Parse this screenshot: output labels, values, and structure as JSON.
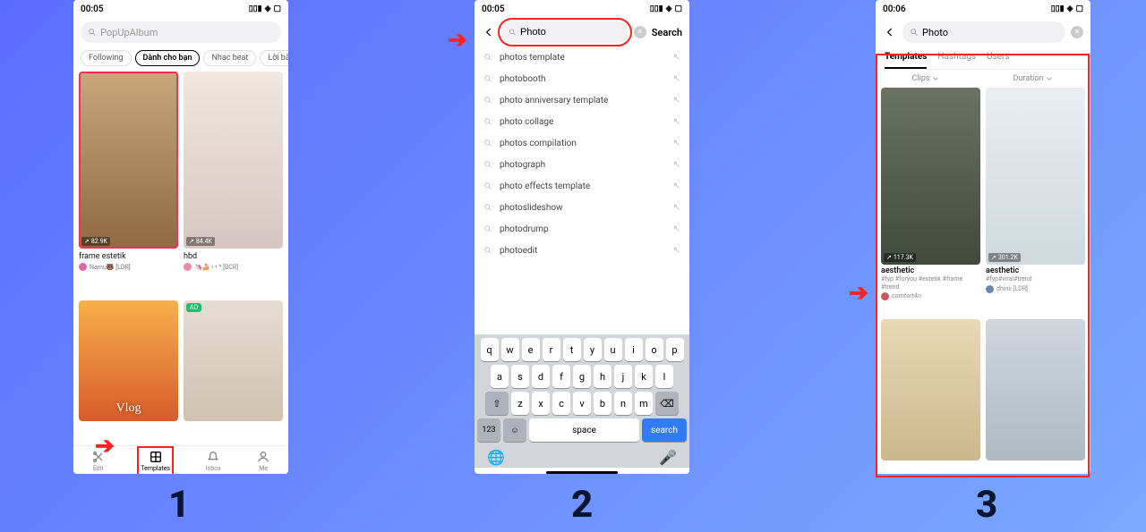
{
  "status": {
    "time1": "00:05",
    "time2": "00:05",
    "time3": "00:06"
  },
  "p1": {
    "search_placeholder": "PopUpAlbum",
    "filters": [
      "Following",
      "Dành cho bạn",
      "Nhạc beat",
      "Lời bài"
    ],
    "cards": [
      {
        "title": "frame estetik",
        "user": "Namu🐻 [LDR]",
        "uses": "82.9K",
        "cls": "img-a"
      },
      {
        "title": "hbd",
        "user": "🦄🍰 • • * [BCR]",
        "uses": "84.4K",
        "cls": "img-b"
      }
    ],
    "more": [
      {
        "label": "Vlog",
        "cls": "img-c"
      },
      {
        "label": "",
        "cls": "img-d",
        "ad": "AD"
      }
    ],
    "tabs": [
      "Edit",
      "Templates",
      "Inbox",
      "Me"
    ]
  },
  "p2": {
    "query": "Photo",
    "search_action": "Search",
    "suggestions": [
      "photos template",
      "photobooth",
      "photo anniversary template",
      "photo collage",
      "photos compilation",
      "photograph",
      "photo effects template",
      "photoslideshow",
      "photodrump",
      "photoedit"
    ],
    "kb_rows": [
      [
        "q",
        "w",
        "e",
        "r",
        "t",
        "y",
        "u",
        "i",
        "o",
        "p"
      ],
      [
        "a",
        "s",
        "d",
        "f",
        "g",
        "h",
        "j",
        "k",
        "l"
      ],
      [
        "z",
        "x",
        "c",
        "v",
        "b",
        "n",
        "m"
      ]
    ],
    "k123": "123",
    "space": "space",
    "go": "search"
  },
  "p3": {
    "query": "Photo",
    "tabs": [
      "Templates",
      "Hashtags",
      "Users"
    ],
    "filters": [
      "Clips",
      "Duration"
    ],
    "results": [
      {
        "title": "aesthetic",
        "tags": "#fyp #foryou #estetik #frame #trend",
        "user": "comfort4n",
        "uses": "117.3K",
        "cls": "img-e"
      },
      {
        "title": "aesthetic",
        "tags": "#fyp#viral#trend",
        "user": "dhinii [LDR]",
        "uses": "301.2K",
        "cls": "img-f"
      }
    ],
    "more": [
      {
        "cls": "img-g"
      },
      {
        "cls": "img-h"
      }
    ]
  },
  "steps": {
    "n1": "1",
    "n2": "2",
    "n3": "3"
  }
}
